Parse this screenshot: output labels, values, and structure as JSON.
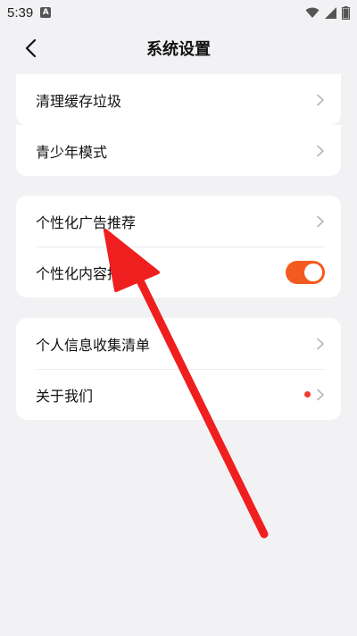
{
  "status_bar": {
    "time": "5:39",
    "badge": "A"
  },
  "header": {
    "title": "系统设置"
  },
  "group1": {
    "items": [
      {
        "label": "清理缓存垃圾"
      }
    ]
  },
  "group2": {
    "items": [
      {
        "label": "青少年模式"
      }
    ]
  },
  "group3": {
    "items": [
      {
        "label": "个性化广告推荐"
      },
      {
        "label": "个性化内容推荐",
        "toggle_on": true
      }
    ]
  },
  "group4": {
    "items": [
      {
        "label": "个人信息收集清单"
      },
      {
        "label": "关于我们",
        "has_red_dot": true
      }
    ]
  },
  "colors": {
    "accent": "#f35a1f",
    "arrow": "#f01f1f",
    "red_dot": "#ef3b2c",
    "background": "#f2f2f4"
  },
  "icons": {
    "back": "chevron-left-icon",
    "row_arrow": "chevron-right-icon",
    "wifi": "wifi-icon",
    "signal": "signal-icon",
    "battery": "battery-icon"
  }
}
